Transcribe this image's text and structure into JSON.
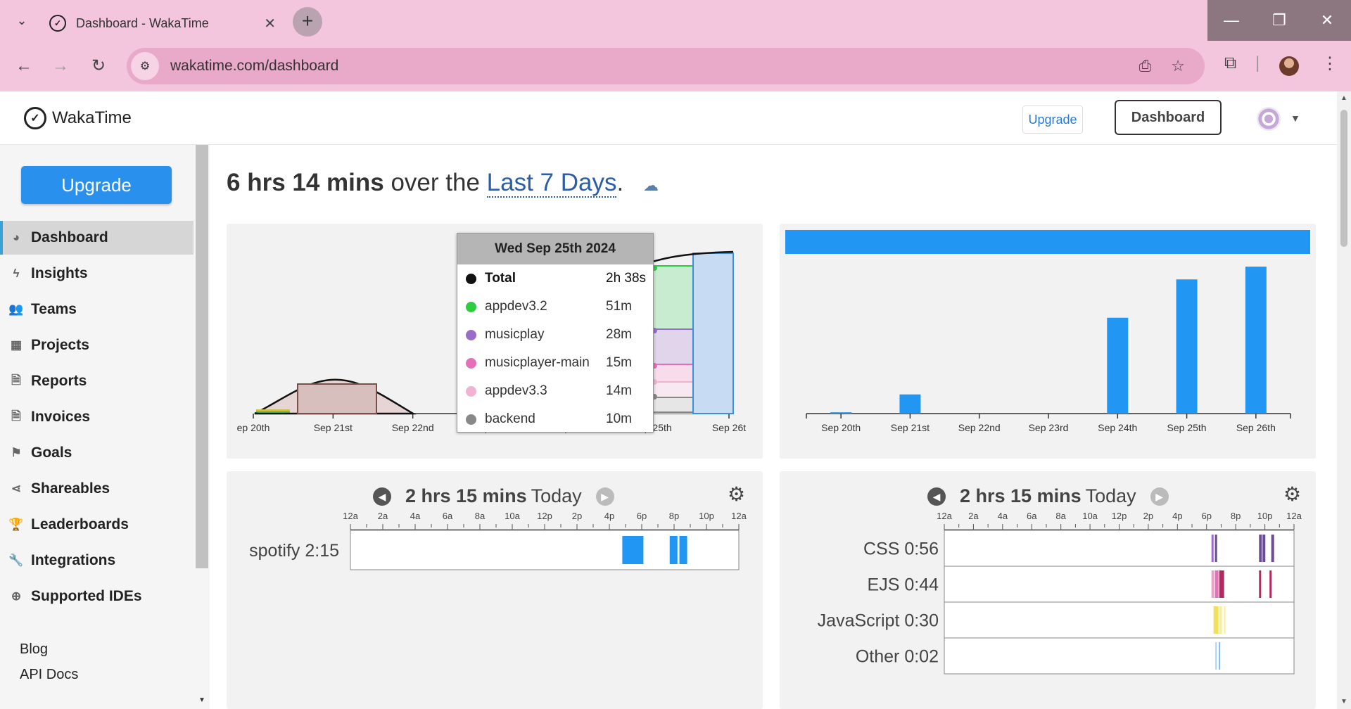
{
  "browser": {
    "tab_title": "Dashboard - WakaTime",
    "url": "wakatime.com/dashboard"
  },
  "header": {
    "logo_text": "WakaTime",
    "upgrade_label": "Upgrade",
    "dashboard_label": "Dashboard"
  },
  "sidebar": {
    "upgrade_label": "Upgrade",
    "items": [
      {
        "label": "Dashboard",
        "icon": "dashboard-icon"
      },
      {
        "label": "Insights",
        "icon": "bolt-icon"
      },
      {
        "label": "Teams",
        "icon": "users-icon"
      },
      {
        "label": "Projects",
        "icon": "grid-icon"
      },
      {
        "label": "Reports",
        "icon": "report-icon"
      },
      {
        "label": "Invoices",
        "icon": "invoice-icon"
      },
      {
        "label": "Goals",
        "icon": "flag-icon"
      },
      {
        "label": "Shareables",
        "icon": "share-icon"
      },
      {
        "label": "Leaderboards",
        "icon": "trophy-icon"
      },
      {
        "label": "Integrations",
        "icon": "wrench-icon"
      },
      {
        "label": "Supported IDEs",
        "icon": "plus-circle-icon"
      }
    ],
    "footer": {
      "blog": "Blog",
      "api_docs": "API Docs"
    }
  },
  "summary": {
    "total": "6 hrs 14 mins",
    "middle": "over the",
    "range": "Last 7 Days",
    "end": "."
  },
  "tooltip": {
    "title": "Wed Sep 25th 2024",
    "rows": [
      {
        "label": "Total",
        "value": "2h 38s",
        "color": "#111111"
      },
      {
        "label": "appdev3.2",
        "value": "51m",
        "color": "#2ecc40"
      },
      {
        "label": "musicplay",
        "value": "28m",
        "color": "#9b6bc8"
      },
      {
        "label": "musicplayer-main",
        "value": "15m",
        "color": "#e56fb9"
      },
      {
        "label": "appdev3.3",
        "value": "14m",
        "color": "#f2b3d3"
      },
      {
        "label": "backend",
        "value": "10m",
        "color": "#888888"
      }
    ]
  },
  "project_chart": {
    "x_labels": [
      "ep 20th",
      "Sep 21st",
      "Sep 22nd",
      "Sep 23rd",
      "Sep 24th",
      "Sep 25th",
      "Sep 26t"
    ]
  },
  "chart_data": [
    {
      "type": "bar",
      "categories": [
        "Sep 20th",
        "Sep 21st",
        "Sep 22nd",
        "Sep 23rd",
        "Sep 24th",
        "Sep 25th",
        "Sep 26th"
      ],
      "values": [
        0.02,
        0.3,
        0,
        0,
        1.5,
        2.1,
        2.3
      ],
      "color": "#2196f3",
      "ylim": [
        0,
        2.4
      ]
    }
  ],
  "today_projects": {
    "total": "2 hrs 15 mins",
    "suffix": "Today",
    "hour_labels": [
      "12a",
      "2a",
      "4a",
      "6a",
      "8a",
      "10a",
      "12p",
      "2p",
      "4p",
      "6p",
      "8p",
      "10p",
      "12a"
    ],
    "rows": [
      {
        "label": "spotify 2:15"
      }
    ]
  },
  "today_languages": {
    "total": "2 hrs 15 mins",
    "suffix": "Today",
    "hour_labels": [
      "12a",
      "2a",
      "4a",
      "6a",
      "8a",
      "10a",
      "12p",
      "2p",
      "4p",
      "6p",
      "8p",
      "10p",
      "12a"
    ],
    "rows": [
      {
        "label": "CSS 0:56"
      },
      {
        "label": "EJS 0:44"
      },
      {
        "label": "JavaScript 0:30"
      },
      {
        "label": "Other 0:02"
      }
    ]
  }
}
